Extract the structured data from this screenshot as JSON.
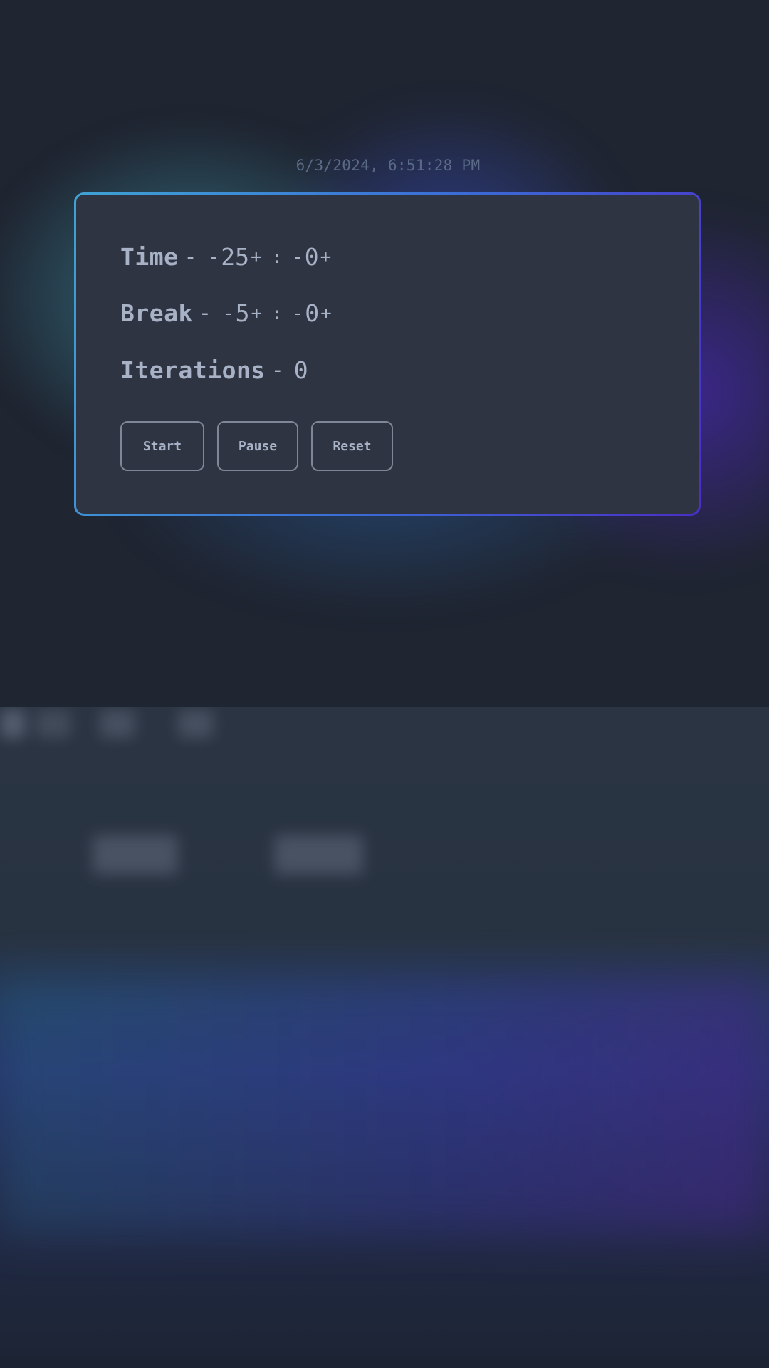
{
  "datetime": "6/3/2024, 6:51:28 PM",
  "timer": {
    "time": {
      "label": "Time",
      "dash": "-",
      "minutes_minus": "-",
      "minutes": "25",
      "minutes_plus": "+",
      "colon": ":",
      "seconds_minus": "-",
      "seconds": "0",
      "seconds_plus": "+"
    },
    "break": {
      "label": "Break",
      "dash": "-",
      "minutes_minus": "-",
      "minutes": "5",
      "minutes_plus": "+",
      "colon": ":",
      "seconds_minus": "-",
      "seconds": "0",
      "seconds_plus": "+"
    },
    "iterations": {
      "label": "Iterations",
      "dash": "-",
      "value": "0"
    }
  },
  "buttons": {
    "start": "Start",
    "pause": "Pause",
    "reset": "Reset"
  },
  "colors": {
    "card_border_start": "#3fa2d4",
    "card_border_end": "#4a2fc6",
    "card_background": "#2e3441",
    "text": "#a8b2c6"
  }
}
